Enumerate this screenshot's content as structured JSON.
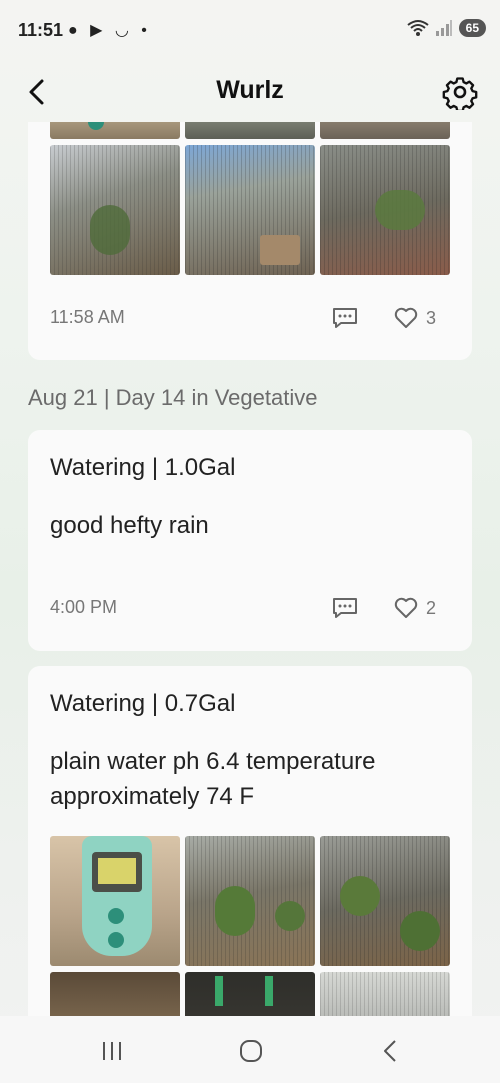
{
  "status_bar": {
    "time": "11:51",
    "notification_icons": "● ▶ ◡ •",
    "battery": "65"
  },
  "app_bar": {
    "title": "Wurlz"
  },
  "posts": [
    {
      "time": "11:58 AM",
      "likes": "3"
    },
    {
      "date_header": "Aug 21 | Day 14 in Vegetative",
      "title": "Watering | 1.0Gal",
      "body": "good hefty rain",
      "time": "4:00 PM",
      "likes": "2"
    },
    {
      "title": "Watering | 0.7Gal",
      "body": "plain water ph 6.4 temperature approximately 74 F"
    }
  ],
  "icons": {
    "back": "chevron-left-icon",
    "settings": "gear-icon",
    "comment": "comment-icon",
    "like": "heart-icon"
  },
  "colors": {
    "card_bg": "#fafafa",
    "muted_text": "#777777",
    "page_gradient": "#e8f0e8"
  }
}
